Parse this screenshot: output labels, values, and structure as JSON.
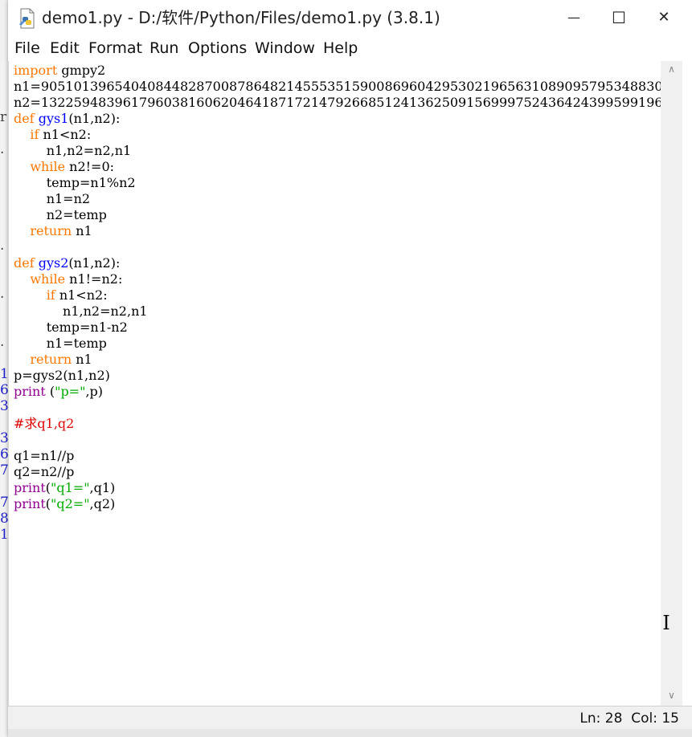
{
  "window": {
    "title": "demo1.py - D:/软件/Python/Files/demo1.py (3.8.1)",
    "minimize_glyph": "—",
    "maximize_glyph": "☐",
    "close_glyph": "✕"
  },
  "menu": [
    "File",
    "Edit",
    "Format",
    "Run",
    "Options",
    "Window",
    "Help"
  ],
  "code_lines": [
    [
      {
        "t": "import",
        "c": "kw"
      },
      {
        "t": " gmpy2"
      }
    ],
    [
      {
        "t": "n1=9051013965404084482870087864821455535159008696042953021965631089095795348830"
      }
    ],
    [
      {
        "t": "n2=1322594839617960381606204641871721479266851241362509156999752436424399599196"
      }
    ],
    [
      {
        "t": "def",
        "c": "kw"
      },
      {
        "t": " "
      },
      {
        "t": "gys1",
        "c": "fn"
      },
      {
        "t": "(n1,n2):"
      }
    ],
    [
      {
        "t": "    "
      },
      {
        "t": "if",
        "c": "kw"
      },
      {
        "t": " n1<n2:"
      }
    ],
    [
      {
        "t": "        n1,n2=n2,n1"
      }
    ],
    [
      {
        "t": "    "
      },
      {
        "t": "while",
        "c": "kw"
      },
      {
        "t": " n2!=0:"
      }
    ],
    [
      {
        "t": "        temp=n1%n2"
      }
    ],
    [
      {
        "t": "        n1=n2"
      }
    ],
    [
      {
        "t": "        n2=temp"
      }
    ],
    [
      {
        "t": "    "
      },
      {
        "t": "return",
        "c": "kw"
      },
      {
        "t": " n1"
      }
    ],
    [
      {
        "t": ""
      }
    ],
    [
      {
        "t": "def",
        "c": "kw"
      },
      {
        "t": " "
      },
      {
        "t": "gys2",
        "c": "fn"
      },
      {
        "t": "(n1,n2):"
      }
    ],
    [
      {
        "t": "    "
      },
      {
        "t": "while",
        "c": "kw"
      },
      {
        "t": " n1!=n2:"
      }
    ],
    [
      {
        "t": "        "
      },
      {
        "t": "if",
        "c": "kw"
      },
      {
        "t": " n1<n2:"
      }
    ],
    [
      {
        "t": "            n1,n2=n2,n1"
      }
    ],
    [
      {
        "t": "        temp=n1-n2"
      }
    ],
    [
      {
        "t": "        n1=temp"
      }
    ],
    [
      {
        "t": "    "
      },
      {
        "t": "return",
        "c": "kw"
      },
      {
        "t": " n1"
      }
    ],
    [
      {
        "t": "p=gys2(n1,n2)"
      }
    ],
    [
      {
        "t": "print",
        "c": "bi"
      },
      {
        "t": " ("
      },
      {
        "t": "\"p=\"",
        "c": "str"
      },
      {
        "t": ",p)"
      }
    ],
    [
      {
        "t": ""
      }
    ],
    [
      {
        "t": "#求q1,q2",
        "c": "cm"
      }
    ],
    [
      {
        "t": ""
      }
    ],
    [
      {
        "t": "q1=n1//p"
      }
    ],
    [
      {
        "t": "q2=n2//p"
      }
    ],
    [
      {
        "t": "print",
        "c": "bi"
      },
      {
        "t": "("
      },
      {
        "t": "\"q1=\"",
        "c": "str"
      },
      {
        "t": ",q1)"
      }
    ],
    [
      {
        "t": "print",
        "c": "bi"
      },
      {
        "t": "("
      },
      {
        "t": "\"q2=\"",
        "c": "str"
      },
      {
        "t": ",q2)"
      }
    ]
  ],
  "background_glyphs": [
    {
      "row": 2,
      "t": "r",
      "c": ""
    },
    {
      "row": 4,
      "t": ".",
      "c": ""
    },
    {
      "row": 10,
      "t": ".",
      "c": ""
    },
    {
      "row": 13,
      "t": ".",
      "c": ""
    },
    {
      "row": 16,
      "t": ".",
      "c": ""
    },
    {
      "row": 18,
      "t": "1",
      "c": "blue"
    },
    {
      "row": 19,
      "t": "6",
      "c": "blue"
    },
    {
      "row": 20,
      "t": "3",
      "c": "blue"
    },
    {
      "row": 22,
      "t": "3",
      "c": "blue"
    },
    {
      "row": 23,
      "t": "6",
      "c": "blue"
    },
    {
      "row": 24,
      "t": "7",
      "c": "blue"
    },
    {
      "row": 26,
      "t": "7",
      "c": "blue"
    },
    {
      "row": 27,
      "t": "8",
      "c": "blue"
    },
    {
      "row": 28,
      "t": "1",
      "c": "blue"
    }
  ],
  "scrollbar": {
    "up_arrow": "∧",
    "down_arrow": "∨"
  },
  "cursor_glyph": "I",
  "status": {
    "line": "Ln: 28",
    "col": "Col: 15"
  }
}
